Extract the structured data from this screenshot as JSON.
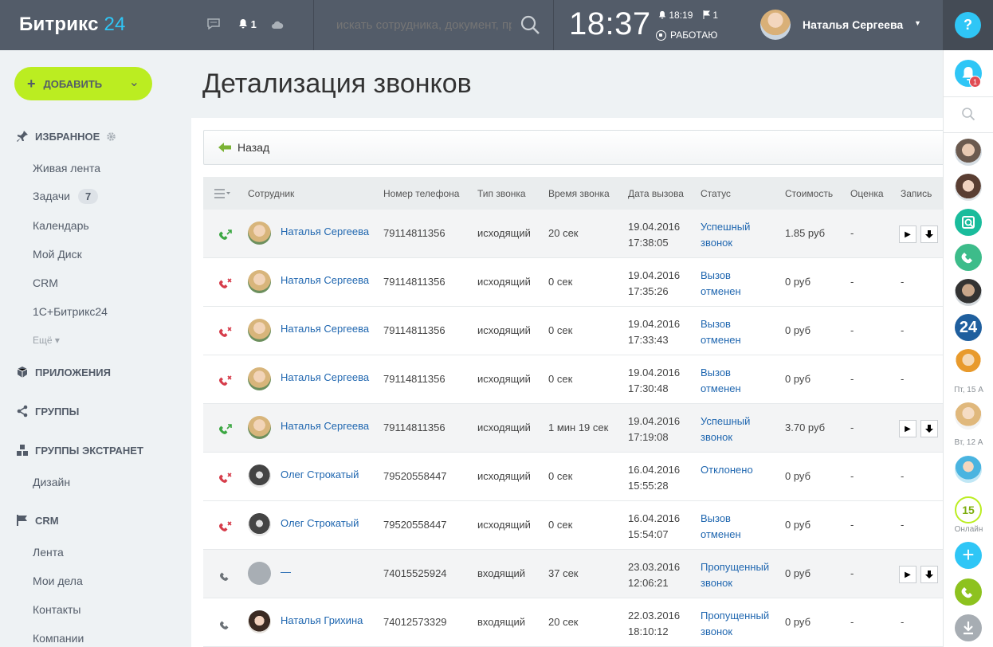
{
  "topbar": {
    "logo_main": "Битрикс",
    "logo_num": "24",
    "bell_count": "1",
    "search_placeholder": "искать сотрудника, документ, пр",
    "clock": "18:37",
    "bell_time": "18:19",
    "flag_count": "1",
    "work_status": "РАБОТАЮ",
    "user_name": "Наталья Сергеева",
    "help": "?"
  },
  "sidebar": {
    "add_label": "ДОБАВИТЬ",
    "favorites": "ИЗБРАННОЕ",
    "fav_items": [
      "Живая лента",
      "Задачи",
      "Календарь",
      "Мой Диск",
      "CRM",
      "1С+Битрикс24"
    ],
    "tasks_badge": "7",
    "more": "Ещё",
    "apps": "ПРИЛОЖЕНИЯ",
    "groups": "ГРУППЫ",
    "extranet": "ГРУППЫ ЭКСТРАНЕТ",
    "extranet_items": [
      "Дизайн"
    ],
    "crm": "CRM",
    "crm_items": [
      "Лента",
      "Мои дела",
      "Контакты",
      "Компании"
    ]
  },
  "page": {
    "title": "Детализация звонков",
    "back": "Назад"
  },
  "table": {
    "headers": [
      "Сотрудник",
      "Номер телефона",
      "Тип звонка",
      "Время звонка",
      "Дата вызова",
      "Статус",
      "Стоимость",
      "Оценка",
      "Запись"
    ],
    "rows": [
      {
        "icon": "outgoing-success",
        "avatar": "natalia",
        "employee": "Наталья Сергеева",
        "phone": "79114811356",
        "type": "исходящий",
        "duration": "20 сек",
        "date": "19.04.2016",
        "time": "17:38:05",
        "status1": "Успешный",
        "status2": "звонок",
        "cost": "1.85 руб",
        "rating": "-",
        "record": true
      },
      {
        "icon": "outgoing-failed",
        "avatar": "natalia",
        "employee": "Наталья Сергеева",
        "phone": "79114811356",
        "type": "исходящий",
        "duration": "0 сек",
        "date": "19.04.2016",
        "time": "17:35:26",
        "status1": "Вызов",
        "status2": "отменен",
        "cost": "0 руб",
        "rating": "-",
        "record": false
      },
      {
        "icon": "outgoing-failed",
        "avatar": "natalia",
        "employee": "Наталья Сергеева",
        "phone": "79114811356",
        "type": "исходящий",
        "duration": "0 сек",
        "date": "19.04.2016",
        "time": "17:33:43",
        "status1": "Вызов",
        "status2": "отменен",
        "cost": "0 руб",
        "rating": "-",
        "record": false
      },
      {
        "icon": "outgoing-failed",
        "avatar": "natalia",
        "employee": "Наталья Сергеева",
        "phone": "79114811356",
        "type": "исходящий",
        "duration": "0 сек",
        "date": "19.04.2016",
        "time": "17:30:48",
        "status1": "Вызов",
        "status2": "отменен",
        "cost": "0 руб",
        "rating": "-",
        "record": false
      },
      {
        "icon": "outgoing-success",
        "avatar": "natalia",
        "employee": "Наталья Сергеева",
        "phone": "79114811356",
        "type": "исходящий",
        "duration": "1 мин 19 сек",
        "date": "19.04.2016",
        "time": "17:19:08",
        "status1": "Успешный",
        "status2": "звонок",
        "cost": "3.70 руб",
        "rating": "-",
        "record": true
      },
      {
        "icon": "outgoing-failed",
        "avatar": "oleg",
        "employee": "Олег Строкатый",
        "phone": "79520558447",
        "type": "исходящий",
        "duration": "0 сек",
        "date": "16.04.2016",
        "time": "15:55:28",
        "status1": "Отклонено",
        "status2": "",
        "cost": "0 руб",
        "rating": "-",
        "record": false
      },
      {
        "icon": "outgoing-failed",
        "avatar": "oleg",
        "employee": "Олег Строкатый",
        "phone": "79520558447",
        "type": "исходящий",
        "duration": "0 сек",
        "date": "16.04.2016",
        "time": "15:54:07",
        "status1": "Вызов",
        "status2": "отменен",
        "cost": "0 руб",
        "rating": "-",
        "record": false
      },
      {
        "icon": "incoming",
        "avatar": "none",
        "employee": "—",
        "phone": "74015525924",
        "type": "входящий",
        "duration": "37 сек",
        "date": "23.03.2016",
        "time": "12:06:21",
        "status1": "Пропущенный",
        "status2": "звонок",
        "cost": "0 руб",
        "rating": "-",
        "record": true
      },
      {
        "icon": "incoming",
        "avatar": "grikh",
        "employee": "Наталья Грихина",
        "phone": "74012573329",
        "type": "входящий",
        "duration": "20 сек",
        "date": "22.03.2016",
        "time": "18:10:12",
        "status1": "Пропущенный",
        "status2": "звонок",
        "cost": "0 руб",
        "rating": "-",
        "record": false
      }
    ],
    "record_dash": "-"
  },
  "rpanel": {
    "notif_count": "1",
    "date1": "Пт, 15 А",
    "date2": "Вт, 12 А",
    "online_count": "15",
    "online_label": "Онлайн",
    "b24": "24"
  },
  "colors": {
    "accent": "#2fc6f6",
    "add": "#bbed21",
    "link": "#2067b0",
    "topbar": "#535c69"
  }
}
